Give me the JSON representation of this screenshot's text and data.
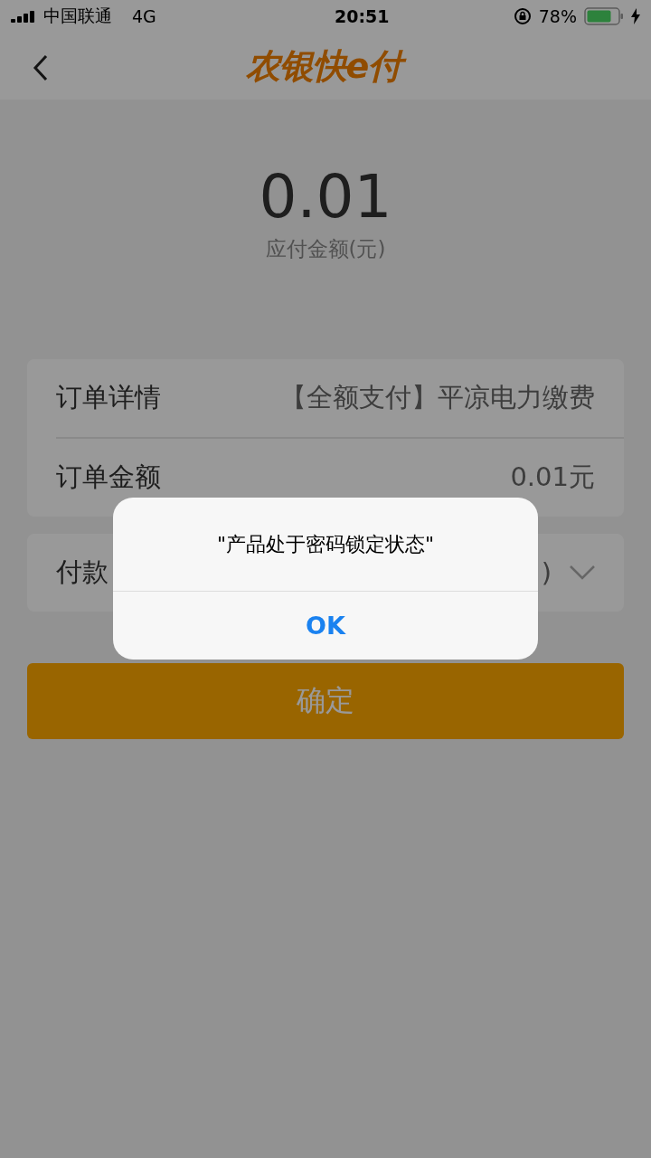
{
  "status_bar": {
    "carrier": "中国联通",
    "network": "4G",
    "time": "20:51",
    "battery": "78%"
  },
  "nav_bar": {
    "logo": "农银快e付"
  },
  "amount": {
    "value": "0.01",
    "label": "应付金额(元)"
  },
  "order_rows": [
    {
      "label": "订单详情",
      "value": "【全额支付】平凉电力缴费"
    },
    {
      "label": "订单金额",
      "value": "0.01元"
    }
  ],
  "payment_row": {
    "label": "付款",
    "value": ")"
  },
  "confirm_button": "确定",
  "alert": {
    "message": "\"产品处于密码锁定状态\"",
    "button": "OK"
  }
}
